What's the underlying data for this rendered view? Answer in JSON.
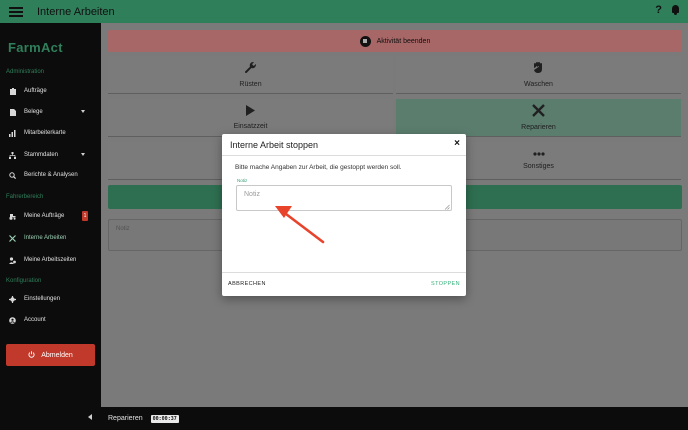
{
  "header": {
    "title": "Interne Arbeiten",
    "help_label": "?"
  },
  "sidebar": {
    "logo": "FarmAct",
    "sections": {
      "admin": "Administration",
      "driver": "Fahrerbereich",
      "config": "Konfiguration"
    },
    "items": [
      {
        "label": "Aufträge"
      },
      {
        "label": "Belege"
      },
      {
        "label": "Mitarbeiterkarte"
      },
      {
        "label": "Stammdaten"
      },
      {
        "label": "Berichte & Analysen"
      },
      {
        "label": "Meine Aufträge",
        "badge": "1"
      },
      {
        "label": "Interne Arbeiten"
      },
      {
        "label": "Meine Arbeitszeiten"
      },
      {
        "label": "Einstellungen"
      },
      {
        "label": "Account"
      }
    ],
    "logout_label": "Abmelden"
  },
  "main": {
    "stop_activity_label": "Aktivität beenden",
    "tiles": [
      {
        "label": "Rüsten"
      },
      {
        "label": "Waschen"
      },
      {
        "label": "Einsatzzeit"
      },
      {
        "label": "Reparieren"
      },
      {
        "label": ""
      },
      {
        "label": "Sonstiges"
      }
    ],
    "notes_placeholder": "Notiz"
  },
  "bottombar": {
    "activity": "Reparieren",
    "timer": "00:00:37"
  },
  "modal": {
    "title": "Interne Arbeit stoppen",
    "close_label": "×",
    "description": "Bitte mache Angaben zur Arbeit, die gestoppt werden soll.",
    "note_label": "Notiz",
    "note_placeholder": "Notiz",
    "note_value": "",
    "cancel_label": "ABBRECHEN",
    "confirm_label": "STOPPEN"
  },
  "colors": {
    "brand": "#2f7f5b",
    "danger": "#c0392b",
    "accent": "#35b07a",
    "annotation_arrow": "#e8432b"
  }
}
